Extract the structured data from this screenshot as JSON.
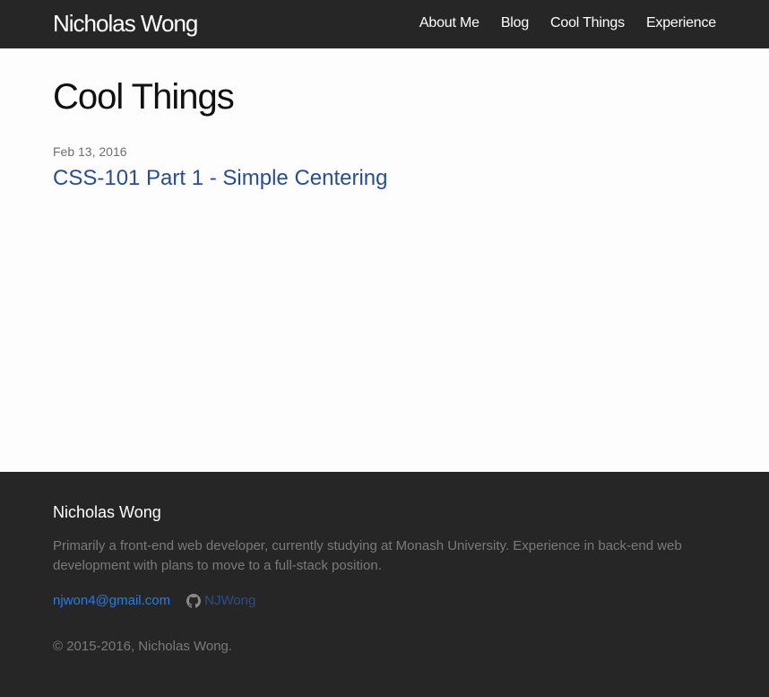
{
  "header": {
    "site_title": "Nicholas Wong",
    "nav": [
      {
        "label": "About Me"
      },
      {
        "label": "Blog"
      },
      {
        "label": "Cool Things"
      },
      {
        "label": "Experience"
      }
    ]
  },
  "main": {
    "heading": "Cool Things",
    "posts": [
      {
        "date": "Feb 13, 2016",
        "title": "CSS-101 Part 1 - Simple Centering"
      }
    ]
  },
  "footer": {
    "heading": "Nicholas Wong",
    "description": "Primarily a front-end web developer, currently studying at Monash University. Experience in back-end web development with plans to move to a full-stack position.",
    "email": "njwon4@gmail.com",
    "github": {
      "icon": "github-icon",
      "username": "NJWong"
    },
    "copyright": "© 2015-2016, Nicholas Wong."
  },
  "colors": {
    "header_bg": "#262626",
    "footer_bg": "#262626",
    "page_bg": "#fdfdfd",
    "post_link": "#2a4e8c",
    "email_link": "#2a7ae2"
  }
}
